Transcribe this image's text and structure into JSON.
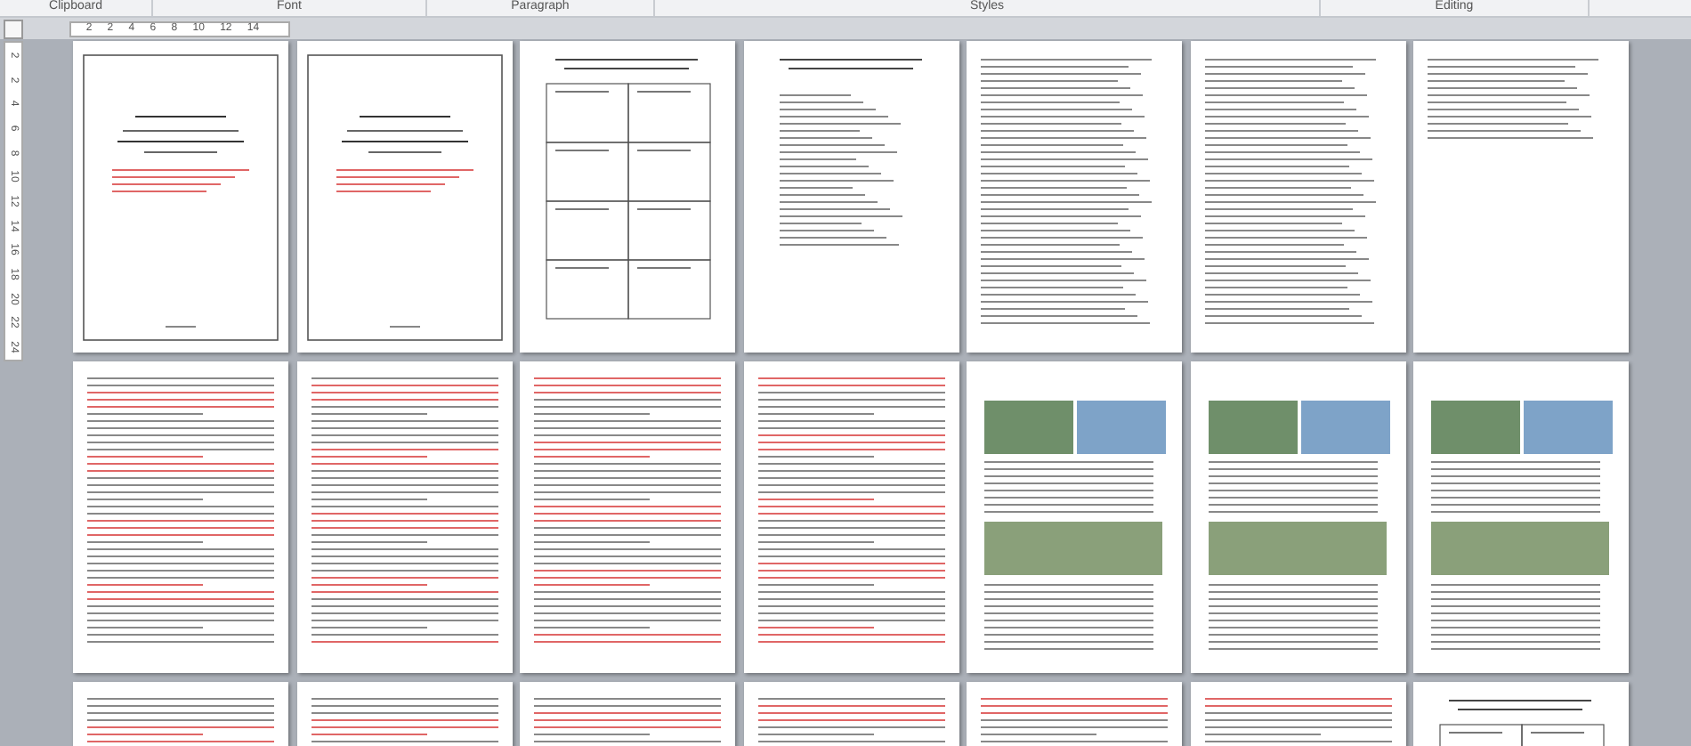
{
  "ribbon_groups": [
    {
      "label": "Clipboard"
    },
    {
      "label": "Font"
    },
    {
      "label": "Paragraph"
    },
    {
      "label": "Styles"
    },
    {
      "label": "Editing"
    }
  ],
  "horizontal_ruler": [
    "2",
    "2",
    "4",
    "6",
    "8",
    "10",
    "12",
    "14"
  ],
  "vertical_ruler": [
    "2",
    "2",
    "4",
    "6",
    "8",
    "10",
    "12",
    "14",
    "16",
    "18",
    "20",
    "22",
    "24"
  ],
  "pages": [
    {
      "kind": "cover"
    },
    {
      "kind": "cover"
    },
    {
      "kind": "table"
    },
    {
      "kind": "list"
    },
    {
      "kind": "toc"
    },
    {
      "kind": "toc"
    },
    {
      "kind": "short"
    },
    {
      "kind": "text"
    },
    {
      "kind": "text"
    },
    {
      "kind": "text"
    },
    {
      "kind": "text"
    },
    {
      "kind": "images"
    },
    {
      "kind": "images"
    },
    {
      "kind": "images"
    },
    {
      "kind": "text"
    },
    {
      "kind": "text"
    },
    {
      "kind": "text"
    },
    {
      "kind": "text"
    },
    {
      "kind": "text"
    },
    {
      "kind": "text"
    },
    {
      "kind": "table"
    }
  ]
}
